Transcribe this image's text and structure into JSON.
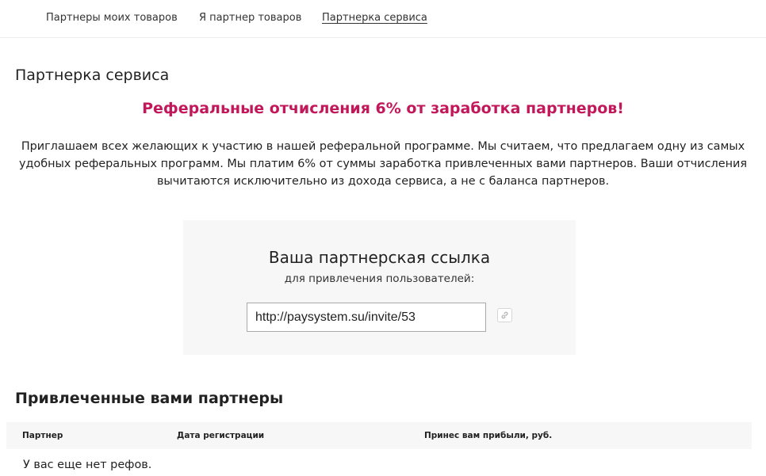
{
  "tabs": [
    {
      "label": "Партнеры моих товаров",
      "active": false
    },
    {
      "label": "Я партнер товаров",
      "active": false
    },
    {
      "label": "Партнерка сервиса",
      "active": true
    }
  ],
  "page": {
    "title": "Партнерка сервиса",
    "promo_heading": "Реферальные отчисления 6% от заработка партнеров!",
    "intro": "Приглашаем всех желающих к участию в нашей реферальной программе. Мы считаем, что предлагаем одну из самых удобных реферальных программ. Мы платим 6% от суммы заработка привлеченных вами партнеров. Ваши отчисления вычитаются исключительно из дохода сервиса, а не с баланса партнеров."
  },
  "referral_link": {
    "title": "Ваша партнерская ссылка",
    "subtitle": "для привлечения пользователей:",
    "url": "http://paysystem.su/invite/53",
    "copy_icon": "link-icon"
  },
  "partners": {
    "title": "Привлеченные вами партнеры",
    "columns": [
      "Партнер",
      "Дата регистрации",
      "Принес вам прибыли, руб."
    ],
    "empty_message": "У вас еще нет рефов."
  },
  "colors": {
    "accent": "#c2185b",
    "panel_bg": "#f7f7f7"
  }
}
